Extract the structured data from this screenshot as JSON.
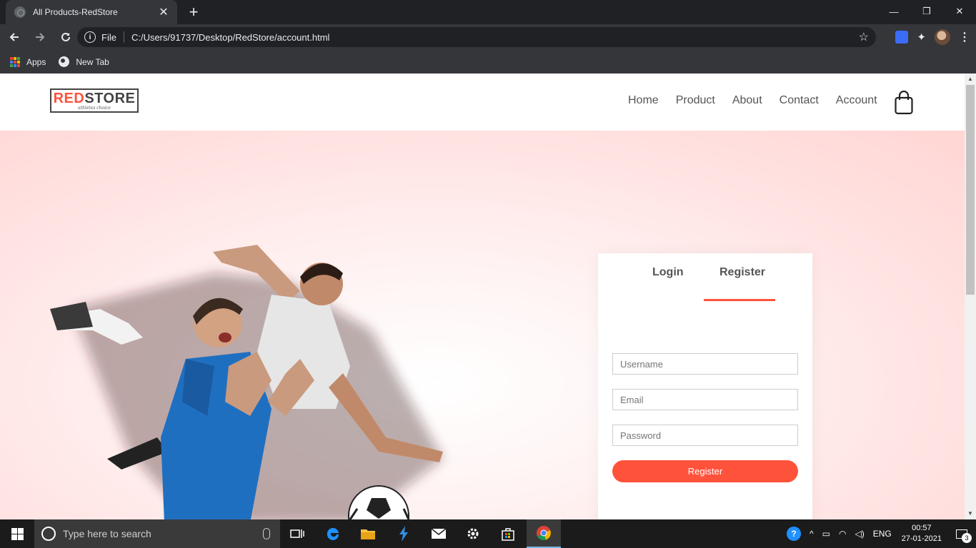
{
  "browser": {
    "tab_title": "All Products-RedStore",
    "tab_close": "✕",
    "new_tab": "+",
    "scheme_label": "File",
    "url": "C:/Users/91737/Desktop/RedStore/account.html",
    "window_controls": {
      "minimize": "—",
      "restore": "❐",
      "close": "✕"
    }
  },
  "bookmarks": [
    {
      "label": "Apps",
      "icon": "apps-grid-icon"
    },
    {
      "label": "New Tab",
      "icon": "globe-icon"
    }
  ],
  "site": {
    "logo": {
      "brand_left": "RED",
      "brand_right": "STORE",
      "tagline": "athletes choice"
    },
    "nav": [
      "Home",
      "Product",
      "About",
      "Contact",
      "Account"
    ],
    "cart_icon": "shopping-bag-icon"
  },
  "form": {
    "tabs": {
      "login": "Login",
      "register": "Register"
    },
    "active_tab": "register",
    "username_placeholder": "Username",
    "email_placeholder": "Email",
    "password_placeholder": "Password",
    "submit_label": "Register",
    "accent_color": "#ff523b"
  },
  "taskbar": {
    "search_placeholder": "Type here to search",
    "language": "ENG",
    "time": "00:57",
    "date": "27-01-2021",
    "notification_count": "3"
  }
}
